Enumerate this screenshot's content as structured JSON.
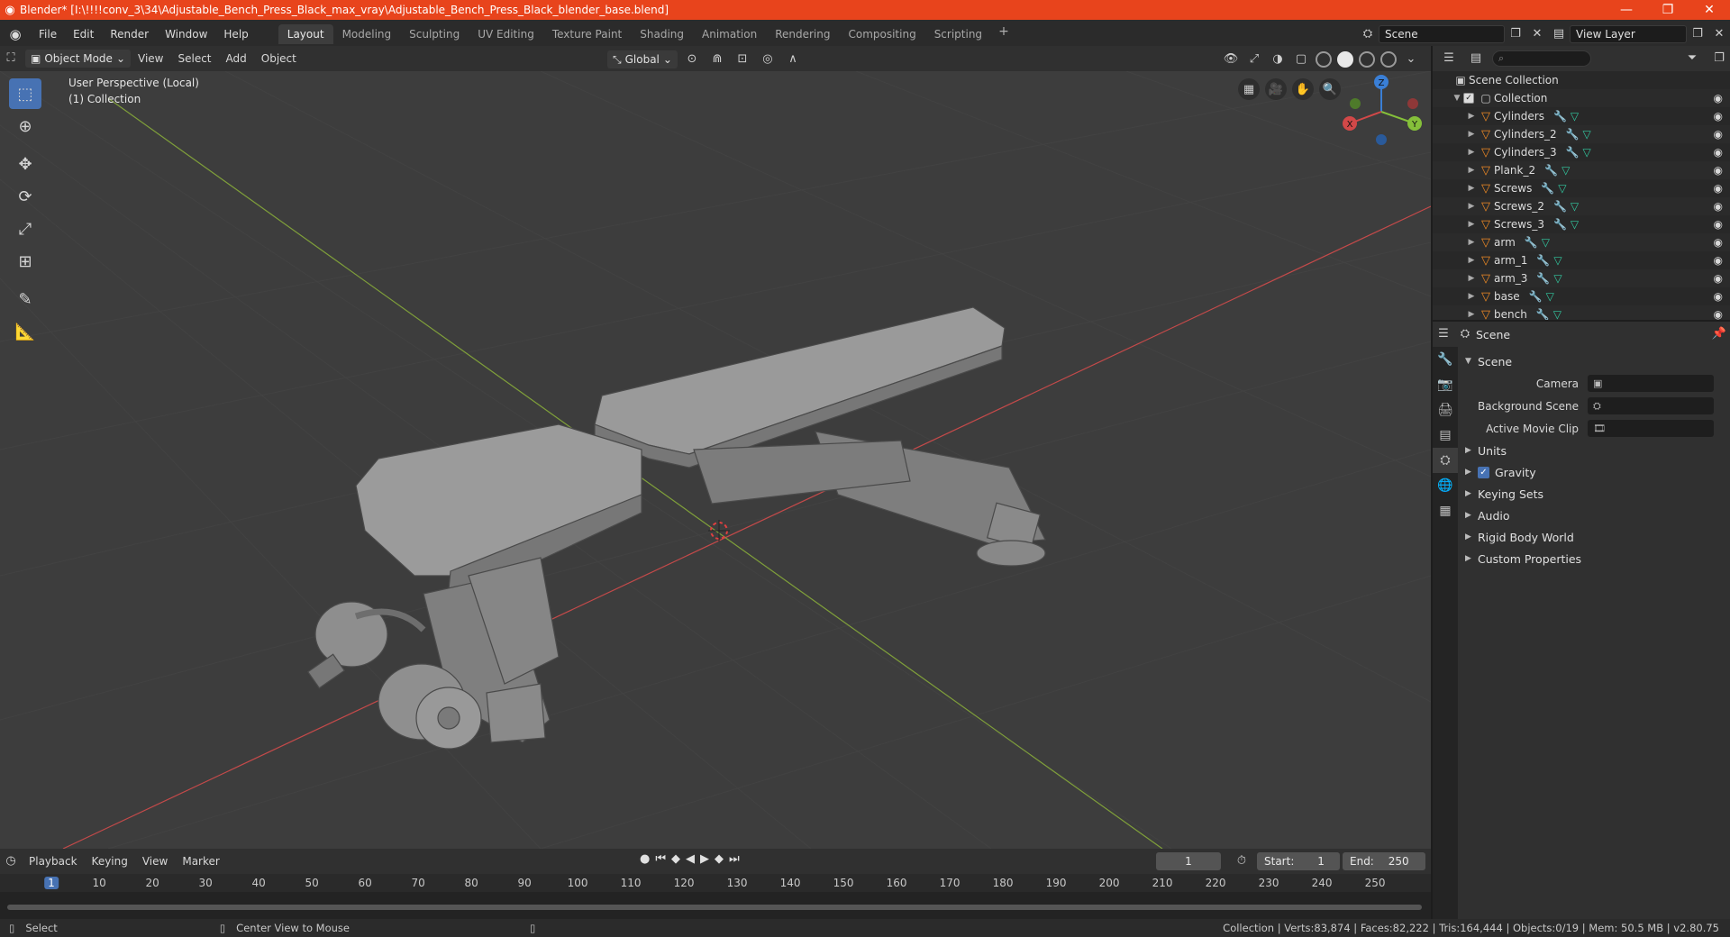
{
  "window": {
    "title": "Blender* [I:\\!!!!conv_3\\34\\Adjustable_Bench_Press_Black_max_vray\\Adjustable_Bench_Press_Black_blender_base.blend]"
  },
  "menu": [
    "File",
    "Edit",
    "Render",
    "Window",
    "Help"
  ],
  "workspaces": [
    "Layout",
    "Modeling",
    "Sculpting",
    "UV Editing",
    "Texture Paint",
    "Shading",
    "Animation",
    "Rendering",
    "Compositing",
    "Scripting"
  ],
  "active_workspace": "Layout",
  "top_right": {
    "scene": "Scene",
    "view_layer": "View Layer"
  },
  "viewport_header": {
    "mode": "Object Mode",
    "menus": [
      "View",
      "Select",
      "Add",
      "Object"
    ],
    "orientation": "Global"
  },
  "viewport": {
    "perspective": "User Perspective (Local)",
    "collection": "(1) Collection",
    "gizmo": {
      "x": "X",
      "y": "Y",
      "z": "Z"
    },
    "colors": {
      "x_axis": "#c44a4a",
      "y_axis": "#7f9f3a",
      "grid": "#464646"
    }
  },
  "outliner": {
    "root": "Scene Collection",
    "collection": "Collection",
    "objects": [
      "Cylinders",
      "Cylinders_2",
      "Cylinders_3",
      "Plank_2",
      "Screws",
      "Screws_2",
      "Screws_3",
      "arm",
      "arm_1",
      "arm_3",
      "base",
      "bench"
    ]
  },
  "properties": {
    "context": "Scene",
    "panel": "Scene",
    "rows": [
      {
        "label": "Camera"
      },
      {
        "label": "Background Scene"
      },
      {
        "label": "Active Movie Clip"
      }
    ],
    "sections": [
      "Units",
      "Gravity",
      "Keying Sets",
      "Audio",
      "Rigid Body World",
      "Custom Properties"
    ],
    "gravity_checked": true
  },
  "timeline": {
    "menus": [
      "Playback",
      "Keying",
      "View",
      "Marker"
    ],
    "current_frame": "1",
    "start_label": "Start:",
    "start": "1",
    "end_label": "End:",
    "end": "250",
    "ticks": [
      "1",
      "10",
      "20",
      "30",
      "40",
      "50",
      "60",
      "70",
      "80",
      "90",
      "100",
      "110",
      "120",
      "130",
      "140",
      "150",
      "160",
      "170",
      "180",
      "190",
      "200",
      "210",
      "220",
      "230",
      "240",
      "250"
    ]
  },
  "statusbar": {
    "left": "Select",
    "middle": "Center View to Mouse",
    "stats": "Collection | Verts:83,874 | Faces:82,222 | Tris:164,444 | Objects:0/19 | Mem: 50.5 MB | v2.80.75"
  }
}
